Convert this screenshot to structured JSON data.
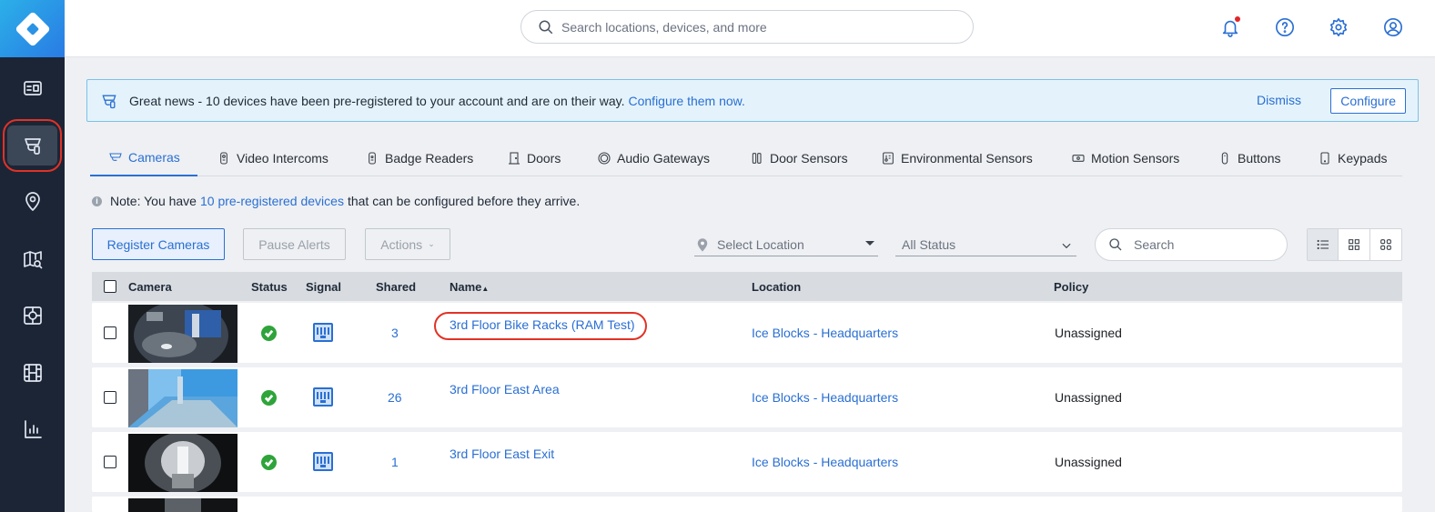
{
  "sidenav": {
    "items": [
      {
        "icon": "dashboard-icon"
      },
      {
        "icon": "devices-camera-icon",
        "active": true
      },
      {
        "icon": "location-pin-icon"
      },
      {
        "icon": "map-search-icon"
      },
      {
        "icon": "floorplan-icon"
      },
      {
        "icon": "film-icon"
      },
      {
        "icon": "analytics-chart-icon"
      }
    ]
  },
  "header": {
    "search_placeholder": "Search locations, devices, and more",
    "icons": [
      "bell-icon",
      "help-icon",
      "gear-icon",
      "user-icon"
    ]
  },
  "banner": {
    "message": "Great news - 10 devices have been pre-registered to your account and are on their way.",
    "link": "Configure them now.",
    "dismiss": "Dismiss",
    "configure": "Configure"
  },
  "tabs": [
    {
      "label": "Cameras",
      "active": true
    },
    {
      "label": "Video Intercoms"
    },
    {
      "label": "Badge Readers"
    },
    {
      "label": "Doors"
    },
    {
      "label": "Audio Gateways"
    },
    {
      "label": "Door Sensors"
    },
    {
      "label": "Environmental Sensors"
    },
    {
      "label": "Motion Sensors"
    },
    {
      "label": "Buttons"
    },
    {
      "label": "Keypads"
    }
  ],
  "note": {
    "prefix": "Note: You have",
    "link": "10 pre-registered devices",
    "suffix": "that can be configured before they arrive."
  },
  "toolbar": {
    "register": "Register Cameras",
    "pause": "Pause Alerts",
    "actions": "Actions",
    "location_placeholder": "Select Location",
    "status_value": "All Status",
    "search_placeholder": "Search"
  },
  "table": {
    "headers": {
      "camera": "Camera",
      "status": "Status",
      "signal": "Signal",
      "shared": "Shared",
      "name": "Name",
      "name_sort": "▲",
      "location": "Location",
      "policy": "Policy"
    },
    "rows": [
      {
        "shared": "3",
        "name": "3rd Floor Bike Racks (RAM Test)",
        "location": "Ice Blocks - Headquarters",
        "policy": "Unassigned"
      },
      {
        "shared": "26",
        "name": "3rd Floor East Area",
        "location": "Ice Blocks - Headquarters",
        "policy": "Unassigned"
      },
      {
        "shared": "1",
        "name": "3rd Floor East Exit",
        "location": "Ice Blocks - Headquarters",
        "policy": "Unassigned"
      }
    ]
  },
  "colors": {
    "accent": "#2a6fd3",
    "nav_bg": "#1b2536",
    "status_ok": "#2ea43a",
    "annotation_red": "#e23226"
  }
}
